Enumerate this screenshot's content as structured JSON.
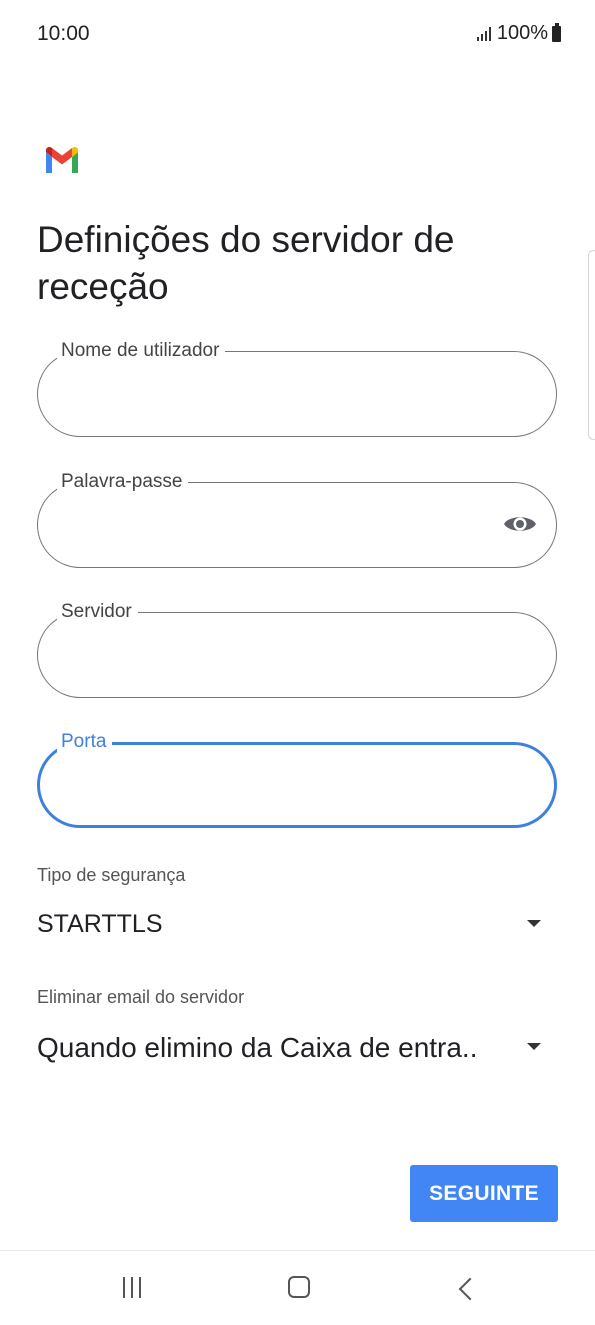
{
  "status_bar": {
    "time": "10:00",
    "battery": "100%"
  },
  "page": {
    "title": "Definições do servidor de receção"
  },
  "fields": {
    "username": {
      "label": "Nome de utilizador",
      "value": ""
    },
    "password": {
      "label": "Palavra-passe",
      "value": ""
    },
    "server": {
      "label": "Servidor",
      "value": ""
    },
    "port": {
      "label": "Porta",
      "value": ""
    }
  },
  "security": {
    "label": "Tipo de segurança",
    "value": "STARTTLS"
  },
  "delete_email": {
    "label": "Eliminar email do servidor",
    "value": "Quando elimino da Caixa de entra.."
  },
  "actions": {
    "next_label": "SEGUINTE"
  },
  "colors": {
    "accent": "#4285f4",
    "focus": "#3f80dc"
  },
  "icons": [
    "gmail-logo",
    "eye-icon",
    "dropdown-arrow-icon",
    "recent-apps-icon",
    "home-icon",
    "back-icon"
  ]
}
